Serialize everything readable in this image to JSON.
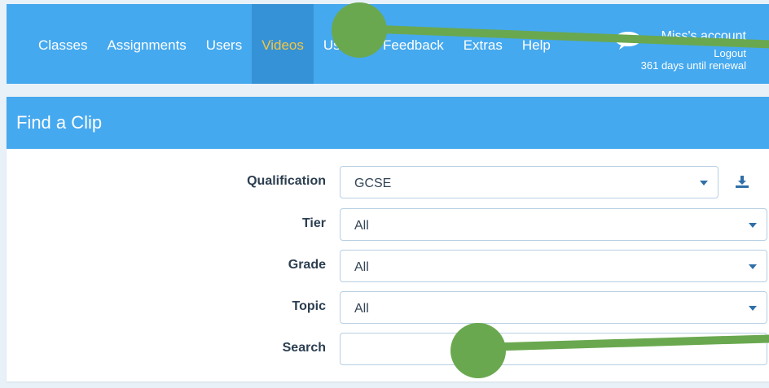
{
  "nav": {
    "items": [
      "Classes",
      "Assignments",
      "Users",
      "Videos",
      "Usage",
      "Feedback",
      "Extras",
      "Help"
    ],
    "active": "Videos"
  },
  "account": {
    "name": "Miss's account",
    "logout": "Logout",
    "renewal": "361 days until renewal"
  },
  "panel": {
    "title": "Find a Clip"
  },
  "filters": {
    "qualification": {
      "label": "Qualification",
      "value": "GCSE"
    },
    "tier": {
      "label": "Tier",
      "value": "All"
    },
    "grade": {
      "label": "Grade",
      "value": "All"
    },
    "topic": {
      "label": "Topic",
      "value": "All"
    },
    "search": {
      "label": "Search",
      "value": ""
    }
  },
  "colors": {
    "header": "#45a9ef",
    "active_nav_bg": "#3692d6",
    "active_nav_text": "#f7c53f",
    "annotation": "#6aa84f"
  }
}
